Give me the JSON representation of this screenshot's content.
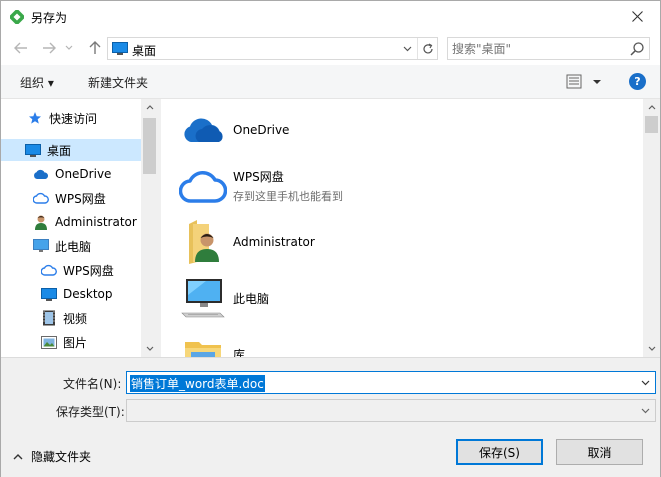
{
  "window": {
    "title": "另存为"
  },
  "address": {
    "location": "桌面"
  },
  "search": {
    "placeholder": "搜索\"桌面\""
  },
  "toolbar": {
    "organize_label": "组织 ▾",
    "new_folder_label": "新建文件夹",
    "help_label": "?"
  },
  "nav": {
    "items": [
      {
        "label": "快速访问",
        "icon": "star-icon"
      },
      {
        "label": "桌面",
        "icon": "desktop-icon",
        "selected": true
      },
      {
        "label": "OneDrive",
        "icon": "onedrive-cloud-icon"
      },
      {
        "label": "WPS网盘",
        "icon": "wps-cloud-icon"
      },
      {
        "label": "Administrator",
        "icon": "user-icon"
      },
      {
        "label": "此电脑",
        "icon": "computer-icon"
      },
      {
        "label": "WPS网盘",
        "icon": "wps-cloud-icon"
      },
      {
        "label": "Desktop",
        "icon": "desktop-icon"
      },
      {
        "label": "视频",
        "icon": "video-icon"
      },
      {
        "label": "图片",
        "icon": "picture-icon"
      }
    ]
  },
  "content": {
    "items": [
      {
        "name": "OneDrive",
        "sub": "",
        "icon": "onedrive-cloud-icon"
      },
      {
        "name": "WPS网盘",
        "sub": "存到这里手机也能看到",
        "icon": "wps-cloud-icon"
      },
      {
        "name": "Administrator",
        "sub": "",
        "icon": "user-folder-icon"
      },
      {
        "name": "此电脑",
        "sub": "",
        "icon": "computer-icon"
      },
      {
        "name": "库",
        "sub": "",
        "icon": "library-folder-icon"
      }
    ]
  },
  "form": {
    "filename_label": "文件名(N):",
    "filename_value": "销售订单_word表单.doc",
    "filetype_label": "保存类型(T):",
    "filetype_value": ""
  },
  "footer": {
    "hide_folders_label": "隐藏文件夹",
    "save_label": "保存(S)",
    "cancel_label": "取消"
  },
  "colors": {
    "accent": "#0078d7",
    "selection": "#cce8ff",
    "cloud_blue": "#1a6fc9",
    "wps_blue": "#2b7de9"
  }
}
